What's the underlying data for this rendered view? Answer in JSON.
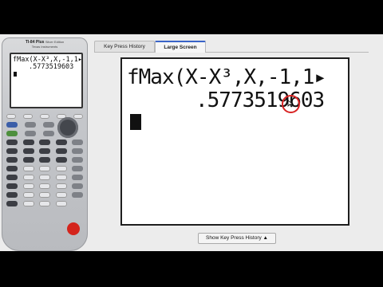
{
  "calculator": {
    "brand": "TI-84 Plus",
    "edition": "Silver Edition",
    "maker": "Texas Instruments",
    "screen_line1": "fMax(X-X³,X,-1,1▸",
    "screen_line2": ".5773519603"
  },
  "tabs": [
    {
      "label": "Key Press History"
    },
    {
      "label": "Large Screen"
    }
  ],
  "large_screen": {
    "line1": "fMax(X-X³,X,-1,1▸",
    "line2": ".5773519603"
  },
  "show_history_button": "Show Key Press History ▲",
  "colors": {
    "enter_key": "#d4241c",
    "highlight": "#d82323",
    "tab_accent": "#3a64c8"
  }
}
